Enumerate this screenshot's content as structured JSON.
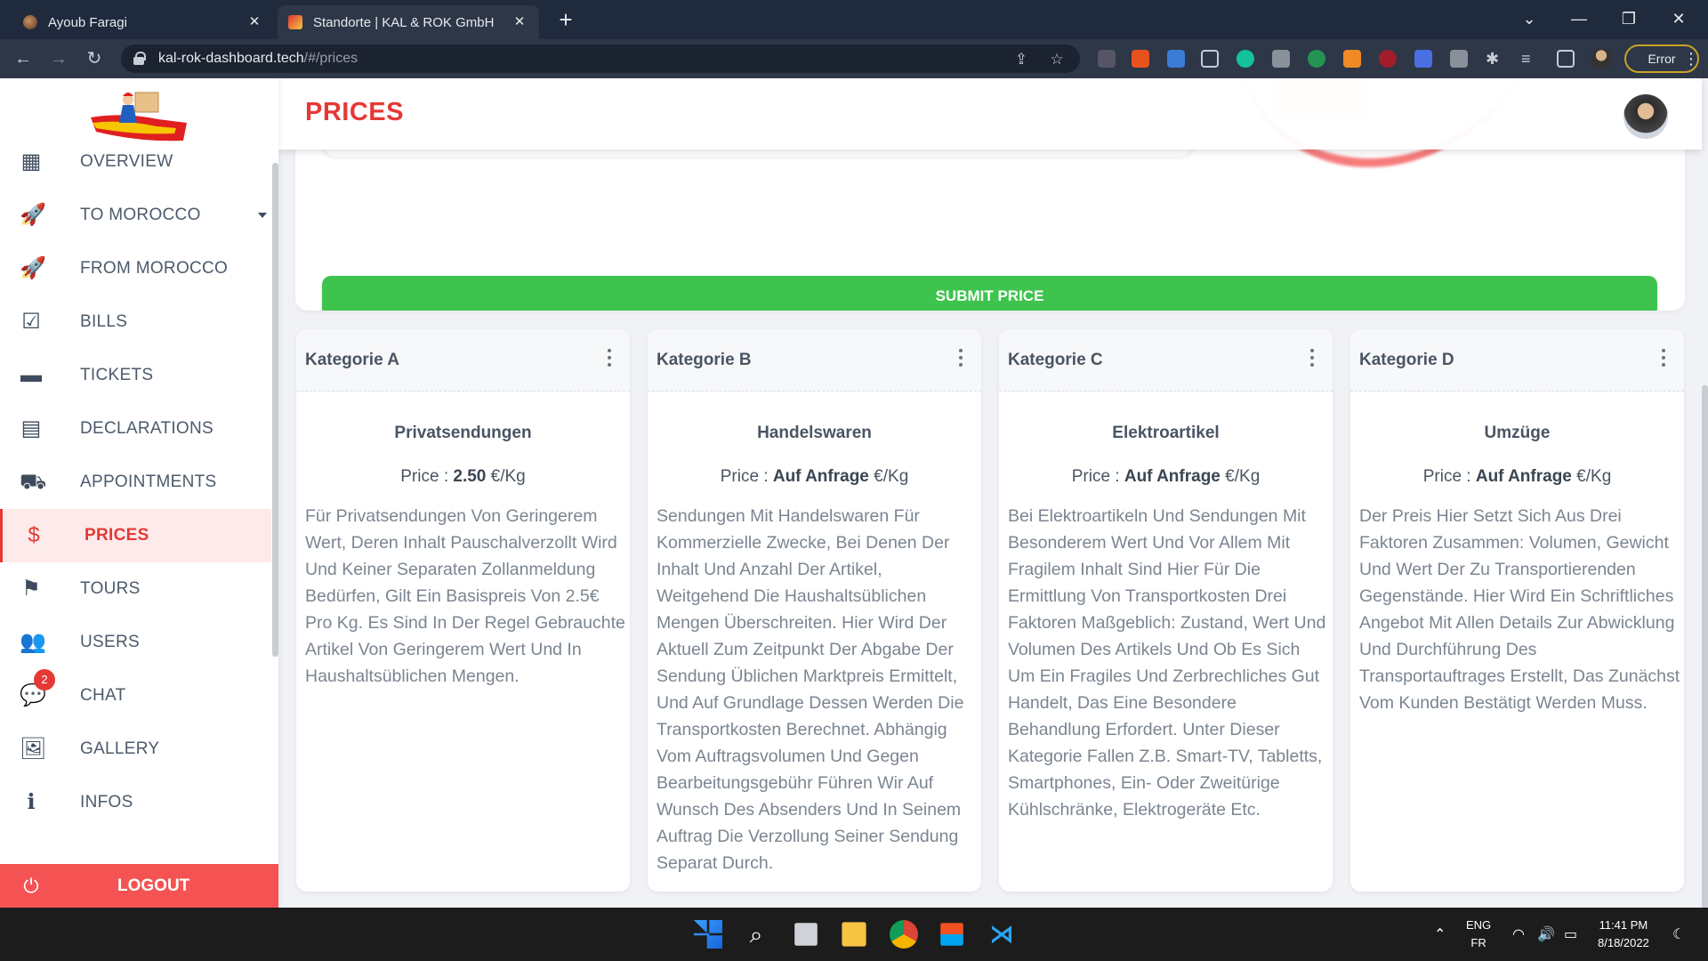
{
  "browser": {
    "tabs": [
      {
        "title": "Ayoub Faragi",
        "active": false
      },
      {
        "title": "Standorte | KAL & ROK GmbH",
        "active": true
      }
    ],
    "url_host": "kal-rok-dashboard.tech",
    "url_path": "/#/prices",
    "error_label": "Error"
  },
  "sidebar": {
    "items": [
      {
        "label": "OVERVIEW",
        "icon": "grid-icon"
      },
      {
        "label": "TO MOROCCO",
        "icon": "rocket-icon"
      },
      {
        "label": "FROM MOROCCO",
        "icon": "rocket-icon"
      },
      {
        "label": "BILLS",
        "icon": "clipboard-check-icon"
      },
      {
        "label": "TICKETS",
        "icon": "ticket-icon"
      },
      {
        "label": "DECLARATIONS",
        "icon": "file-icon"
      },
      {
        "label": "APPOINTMENTS",
        "icon": "truck-clock-icon"
      },
      {
        "label": "PRICES",
        "icon": "dollar-icon"
      },
      {
        "label": "TOURS",
        "icon": "flag-icon"
      },
      {
        "label": "USERS",
        "icon": "users-icon"
      },
      {
        "label": "CHAT",
        "icon": "chat-icon",
        "badge": "2"
      },
      {
        "label": "GALLERY",
        "icon": "image-icon"
      },
      {
        "label": "INFOS",
        "icon": "info-icon"
      }
    ],
    "logout": "LOGOUT",
    "active_color": "#e53935"
  },
  "header": {
    "title": "PRICES"
  },
  "form": {
    "submit_label": "SUBMIT PRICE",
    "submit_color": "#3ec44e"
  },
  "categories": [
    {
      "name": "Kategorie A",
      "title": "Privatsendungen",
      "price_prefix": "Price : ",
      "price_value": "2.50",
      "price_unit": " €/Kg",
      "description": "Für Privatsendungen Von Geringerem Wert, Deren Inhalt Pauschalverzollt Wird Und Keiner Separaten Zollanmeldung Bedürfen, Gilt Ein Basispreis Von 2.5€ Pro Kg. Es Sind In Der Regel Gebrauchte Artikel Von Geringerem Wert Und In Haushaltsüblichen Mengen."
    },
    {
      "name": "Kategorie B",
      "title": "Handelswaren",
      "price_prefix": "Price : ",
      "price_value": "Auf Anfrage",
      "price_unit": " €/Kg",
      "description": "Sendungen Mit Handelswaren Für Kommerzielle Zwecke, Bei Denen Der Inhalt Und Anzahl Der Artikel, Weitgehend Die Haushaltsüblichen Mengen Überschreiten. Hier Wird Der Aktuell Zum Zeitpunkt Der Abgabe Der Sendung Üblichen Marktpreis Ermittelt, Und Auf Grundlage Dessen Werden Die Transportkosten Berechnet. Abhängig Vom Auftragsvolumen Und Gegen Bearbeitungsgebühr Führen Wir Auf Wunsch Des Absenders Und In Seinem Auftrag Die Verzollung Seiner Sendung Separat Durch."
    },
    {
      "name": "Kategorie C",
      "title": "Elektroartikel",
      "price_prefix": "Price : ",
      "price_value": "Auf Anfrage",
      "price_unit": " €/Kg",
      "description": "Bei Elektroartikeln Und Sendungen Mit Besonderem Wert Und Vor Allem Mit Fragilem Inhalt Sind Hier Für Die Ermittlung Von Transportkosten Drei Faktoren Maßgeblich: Zustand, Wert Und Volumen Des Artikels Und Ob Es Sich Um Ein Fragiles Und Zerbrechliches Gut Handelt, Das Eine Besondere Behandlung Erfordert. Unter Dieser Kategorie Fallen Z.B. Smart-TV, Tabletts, Smartphones, Ein- Oder Zweitürige Kühlschränke, Elektrogeräte Etc."
    },
    {
      "name": "Kategorie D",
      "title": "Umzüge",
      "price_prefix": "Price : ",
      "price_value": "Auf Anfrage",
      "price_unit": " €/Kg",
      "description": "Der Preis Hier Setzt Sich Aus Drei Faktoren Zusammen: Volumen, Gewicht Und Wert Der Zu Transportierenden Gegenstände. Hier Wird Ein Schriftliches Angebot Mit Allen Details Zur Abwicklung Und Durchführung Des Transportauftrages Erstellt, Das Zunächst Vom Kunden Bestätigt Werden Muss."
    }
  ],
  "taskbar": {
    "lang_top": "ENG",
    "lang_bottom": "FR",
    "time": "11:41 PM",
    "date": "8/18/2022"
  }
}
